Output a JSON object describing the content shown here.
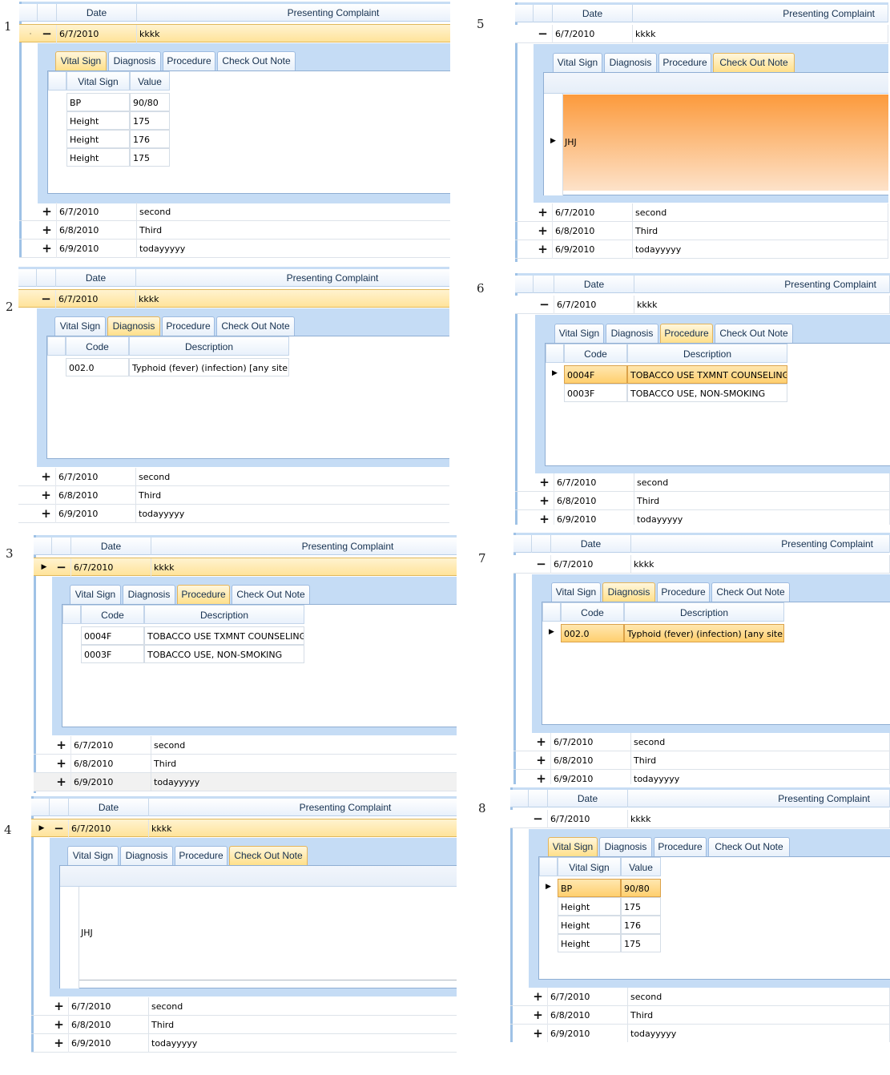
{
  "panel_labels": [
    "1",
    "2",
    "3",
    "4",
    "5",
    "6",
    "7",
    "8"
  ],
  "grid": {
    "columns": {
      "date": "Date",
      "complaint": "Presenting Complaint"
    },
    "rows": [
      {
        "date": "6/7/2010",
        "complaint": "kkkk",
        "expander": "−"
      },
      {
        "date": "6/7/2010",
        "complaint": "second",
        "expander": "+"
      },
      {
        "date": "6/8/2010",
        "complaint": "Third",
        "expander": "+"
      },
      {
        "date": "6/9/2010",
        "complaint": "todayyyyy",
        "expander": "+"
      }
    ]
  },
  "tabs": [
    "Vital Sign",
    "Diagnosis",
    "Procedure",
    "Check Out Note"
  ],
  "vital_signs": {
    "columns": {
      "name": "Vital Sign",
      "value": "Value"
    },
    "rows": [
      {
        "name": "BP",
        "value": "90/80"
      },
      {
        "name": "Height",
        "value": "175"
      },
      {
        "name": "Height",
        "value": "176"
      },
      {
        "name": "Height",
        "value": "175"
      }
    ]
  },
  "diagnosis": {
    "columns": {
      "code": "Code",
      "description": "Description"
    },
    "rows": [
      {
        "code": "002.0",
        "description": "Typhoid (fever) (infection) [any site]"
      }
    ]
  },
  "procedure": {
    "columns": {
      "code": "Code",
      "description": "Description"
    },
    "rows": [
      {
        "code": "0004F",
        "description": "TOBACCO USE TXMNT COUNSELING"
      },
      {
        "code": "0003F",
        "description": "TOBACCO USE, NON-SMOKING"
      }
    ]
  },
  "checkout_note": {
    "text": "JHJ"
  },
  "glyphs": {
    "row_indicator": "▶"
  },
  "colors": {
    "selection": "#ffe39a",
    "tab_active": "#ffe08a",
    "detail_background": "#c5dcf5",
    "note_highlight": "#fc9a3c"
  }
}
